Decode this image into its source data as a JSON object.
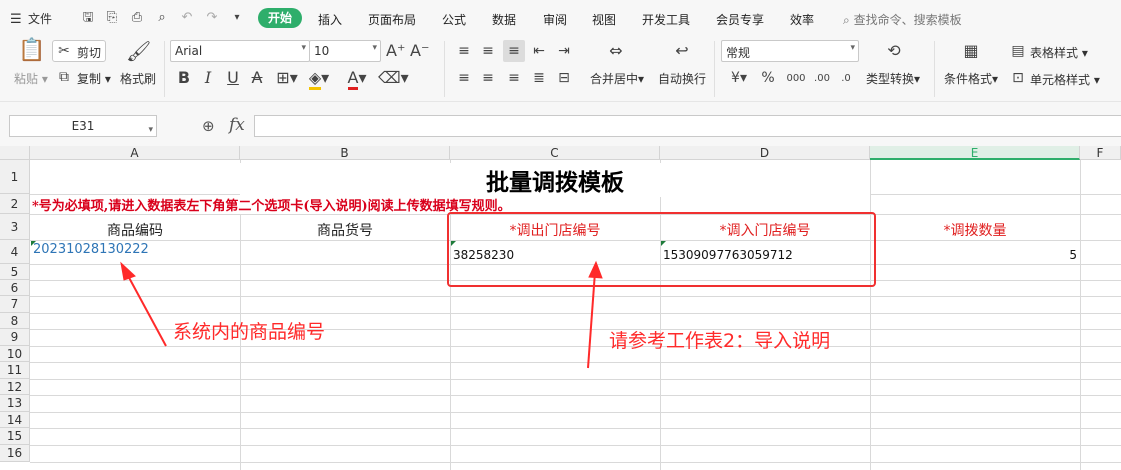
{
  "menu": {
    "file_label": "文件",
    "tabs": [
      "开始",
      "插入",
      "页面布局",
      "公式",
      "数据",
      "审阅",
      "视图",
      "开发工具",
      "会员专享",
      "效率"
    ],
    "search_placeholder": "查找命令、搜索模板"
  },
  "ribbon": {
    "paste": "粘贴",
    "cut": "剪切",
    "copy": "复制",
    "format_painter": "格式刷",
    "font_name": "Arial",
    "font_size": "10",
    "merge_center": "合并居中",
    "wrap_text": "自动换行",
    "number_format": "常规",
    "type_convert": "类型转换",
    "conditional_format": "条件格式",
    "table_style": "表格样式",
    "cell_style": "单元格样式"
  },
  "formula_bar": {
    "cell_ref": "E31",
    "fx": "fx",
    "content": ""
  },
  "sheet": {
    "columns": [
      "A",
      "B",
      "C",
      "D",
      "E",
      "F"
    ],
    "rows": [
      "1",
      "2",
      "3",
      "4",
      "5",
      "6",
      "7",
      "8",
      "9",
      "10",
      "11",
      "12",
      "13",
      "14",
      "15",
      "16"
    ],
    "title": "批量调拨模板",
    "note": "*号为必填项,请进入数据表左下角第二个选项卡(导入说明)阅读上传数据填写规则。",
    "headers": [
      "商品编码",
      "商品货号",
      "*调出门店编号",
      "*调入门店编号",
      "*调拨数量"
    ],
    "row4": {
      "product_code": "20231028130222",
      "from_store": "38258230",
      "to_store": "15309097763059712",
      "quantity": "5"
    }
  },
  "annotations": {
    "product_code_note": "系统内的商品编号",
    "sheet2_note": "请参考工作表2：导入说明",
    "color": "#ff2a2a"
  },
  "colors": {
    "accent": "#2eae6b",
    "required_red": "#e02020",
    "link_blue": "#2e75b6"
  }
}
